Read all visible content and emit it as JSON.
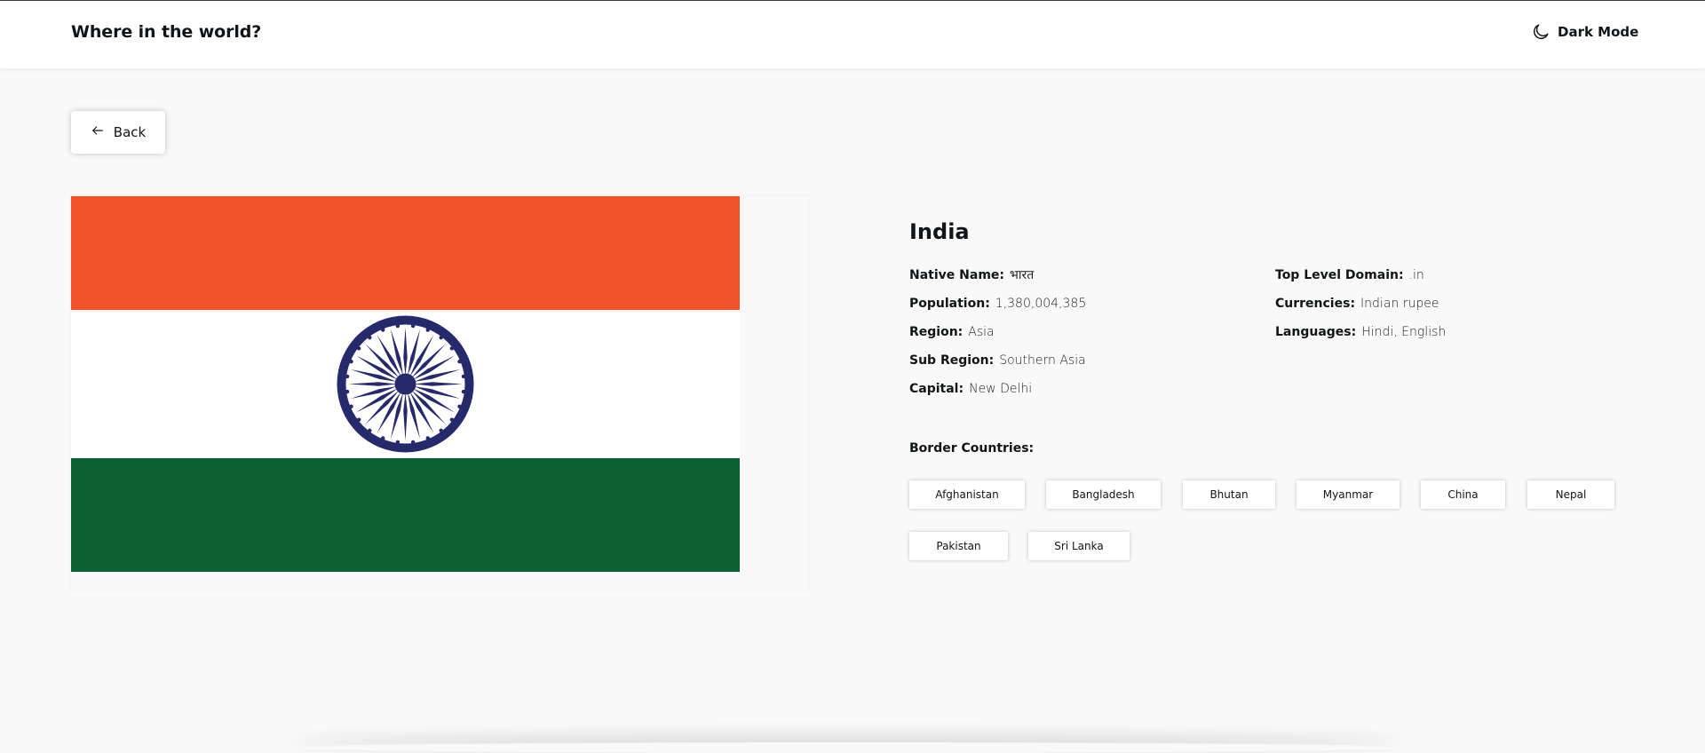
{
  "header": {
    "title": "Where in the world?",
    "theme_toggle_label": "Dark Mode",
    "theme_toggle_icon": "moon-icon"
  },
  "back_button": {
    "label": "Back",
    "icon": "arrow-left-icon"
  },
  "flag": {
    "country": "India",
    "colors": {
      "saffron": "#F15129",
      "white": "#FFFFFF",
      "green": "#0C6134",
      "chakra": "#262A6A"
    }
  },
  "country": {
    "name": "India",
    "left_fields": [
      {
        "label": "Native Name:",
        "value": "भारत"
      },
      {
        "label": "Population:",
        "value": "1,380,004,385"
      },
      {
        "label": "Region:",
        "value": "Asia"
      },
      {
        "label": "Sub Region:",
        "value": "Southern Asia"
      },
      {
        "label": "Capital:",
        "value": "New Delhi"
      }
    ],
    "right_fields": [
      {
        "label": "Top Level Domain:",
        "value": ".in"
      },
      {
        "label": "Currencies:",
        "value": "Indian rupee"
      },
      {
        "label": "Languages:",
        "value": "Hindi, English"
      }
    ],
    "border_title": "Border Countries:",
    "border_countries": [
      "Afghanistan",
      "Bangladesh",
      "Bhutan",
      "Myanmar",
      "China",
      "Nepal",
      "Pakistan",
      "Sri Lanka"
    ]
  }
}
